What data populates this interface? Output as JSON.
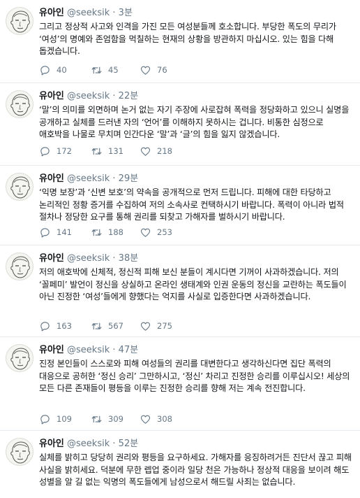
{
  "user": {
    "name": "유아인",
    "handle": "@seeksik",
    "separator": "·"
  },
  "tweets": [
    {
      "time": "3분",
      "text": "그리고 정상적 사고와 인격을 가진 모든 여성분들께 호소합니다. 부당한 폭도의 무리가 ‘여성’의 명예와 존엄함을 먹칠하는 현재의 상황을 방관하지 마십시오. 있는 힘을 다해 돕겠습니다.",
      "replies": "40",
      "retweets": "45",
      "likes": "76"
    },
    {
      "time": "22분",
      "text": "‘말’의 의미를 외면하며 논거 없는 자기 주장에 사로잡혀 폭력을 정당화하고 있으니 실명을 공개하고 실체를 드러낸 자의 ‘언어’를 이해하지 못하시는 겁니다. 비통한 심정으로 애호박을 나물로 무치며 인간다운 ‘말’과 ‘글’의 힘을 잃지 않겠습니다.",
      "replies": "172",
      "retweets": "131",
      "likes": "218"
    },
    {
      "time": "29분",
      "text": "‘익명 보장’과 ‘신변 보호’의 약속을 공개적으로 먼저 드립니다. 피해에 대한 타당하고 논리적인 정황 증거를 수집하여 저의 소속사로 컨택하시기 바랍니다. 폭력이 아니라 법적 절차나 정당한 요구를 통해 권리를 되찾고 가해자를 벌하시기 바랍니다.",
      "replies": "141",
      "retweets": "188",
      "likes": "253"
    },
    {
      "time": "38분",
      "text": "저의 애호박에 신체적, 정신적 피해 보신 분들이 계시다면 기꺼이 사과하겠습니다. 저의 ‘꼴페미’ 발언이 정신을 상실하고 온라인 생태계와 인권 운동의 정신을 교란하는 폭도들이 아닌 진정한 ‘여성’들에게 향했다는 억지를 사실로 입증한다면 사과하겠습니다.",
      "replies": "163",
      "retweets": "567",
      "likes": "275"
    },
    {
      "time": "47분",
      "text": "진정 본인들이 스스로와 피해 여성들의 권리를 대변한다고 생각하신다면 집단 폭력의 대응으로 공허한 ‘정신 승리’ 그만하시고, ‘정신’ 차리고 진정한 승리를 이루십시오! 세상의 모든 다른 존재들이 평등을 이루는 진정한 승리를 향해 저는 계속 전진합니다.",
      "replies": "109",
      "retweets": "309",
      "likes": "308"
    },
    {
      "time": "52분",
      "text": "실체를 밝히고 당당히 권리와 평등을 요구하세요. 가해자를 응징하려거든 진단서 끊고 피해 사실을 밝히세요. 덕분에 무한 렙업 중이라 일당 천은 가능하나 정상적 대응을 보이려 해도 성별을 알 길 없는 익명의 폭도들에게 남성으로서 해드릴 사죄는 없습니다.",
      "replies": "",
      "retweets": "",
      "likes": ""
    }
  ]
}
